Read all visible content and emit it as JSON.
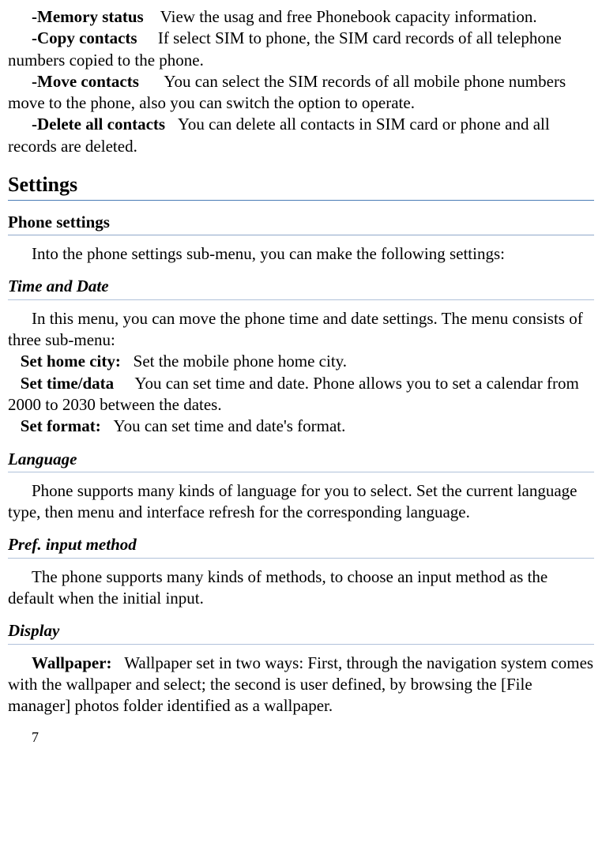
{
  "items": [
    {
      "label": "-Memory status",
      "desc_before": "",
      "desc_after": "View the usag and free Phonebook capacity information."
    },
    {
      "label": "-Copy contacts",
      "desc_before": "",
      "desc_after": "If select SIM to phone, the SIM card records of all telephone numbers copied to the phone."
    },
    {
      "label": "-Move contacts",
      "desc_before": "",
      "desc_after": "You can select the SIM records of all mobile phone numbers move to the phone, also you can switch the option to operate."
    },
    {
      "label": "-Delete all contacts",
      "desc_before": "",
      "desc_after": "You can delete all contacts in SIM card or phone and all records are deleted."
    }
  ],
  "settings_heading": "Settings",
  "phone_settings_heading": "Phone settings",
  "phone_settings_intro": "Into the phone settings sub-menu, you can make the following settings:",
  "time_date_heading": "Time and Date",
  "time_date_intro": "In this menu, you can move the phone time and date settings. The menu consists of three sub-menu:",
  "time_date_items": [
    {
      "label": "Set home city:",
      "desc": "Set the mobile phone home city."
    },
    {
      "label": "Set time/data",
      "desc": "You can set time and date. Phone allows you to set a calendar from 2000 to 2030 between the dates."
    },
    {
      "label": "Set format:",
      "desc": "You can set time and date's format."
    }
  ],
  "language_heading": "Language",
  "language_body": "Phone supports many kinds of language for you to select. Set the current language type, then menu and interface refresh for the corresponding language.",
  "pref_input_heading": "Pref. input method",
  "pref_input_body": "The phone supports many kinds of methods, to choose an input method as the default when the initial input.",
  "display_heading": "Display",
  "display_item": {
    "label": "Wallpaper:",
    "desc": "Wallpaper set in two ways: First, through the navigation system comes with the wallpaper and select; the second is user defined, by browsing the [File manager] photos folder identified as a wallpaper."
  },
  "page_number": "7"
}
